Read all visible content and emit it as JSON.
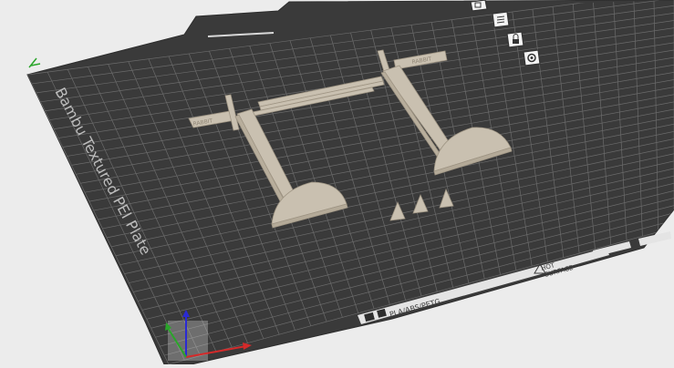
{
  "plate": {
    "name": "Bambu Textured PEI Plate",
    "filament_label": "PLA/ABS/PETG",
    "surface_label_line1": "HOT",
    "surface_label_line2": "SURFACE"
  },
  "model": {
    "engraved_text_left": "RABBIT",
    "engraved_text_right": "RABBIT"
  },
  "toolbar": {
    "icons": [
      "layers-icon",
      "list-icon",
      "lock-icon",
      "settings-icon"
    ]
  },
  "colors": {
    "background": "#ececec",
    "plate": "#3a3a3a",
    "grid": "#6e6e6e",
    "model": "#c9c0b0",
    "axis_x": "#d42a2a",
    "axis_y": "#2aa52a",
    "axis_z": "#2a2ad4"
  }
}
